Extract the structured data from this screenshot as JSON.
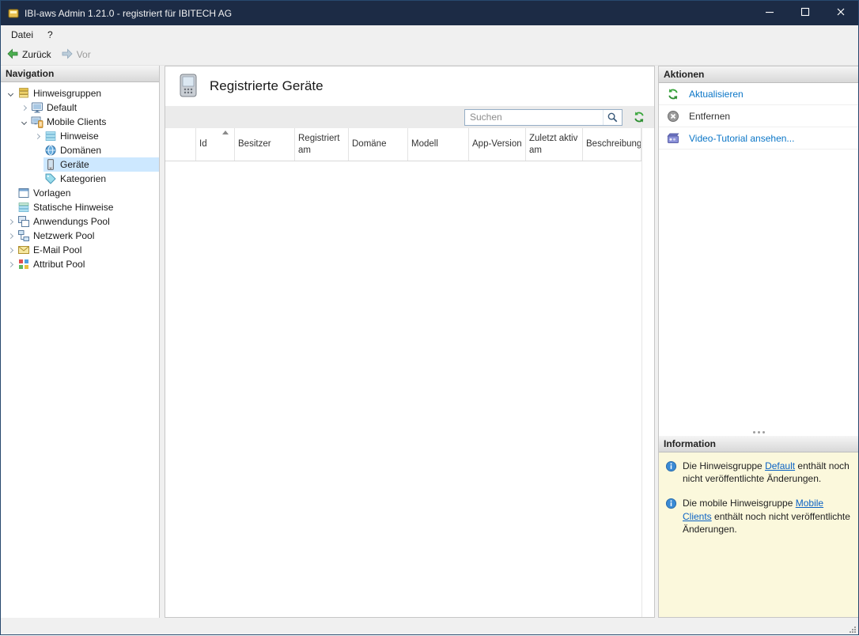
{
  "window": {
    "title": "IBI-aws Admin 1.21.0 - registriert für IBITECH AG",
    "controls": [
      "minimize",
      "maximize",
      "close"
    ]
  },
  "menu": {
    "items": [
      "Datei",
      "?"
    ]
  },
  "toolbar": {
    "back_label": "Zurück",
    "forward_label": "Vor"
  },
  "navigation": {
    "header": "Navigation",
    "tree": [
      {
        "label": "Hinweisgruppen",
        "level": 0,
        "expander": "open",
        "icon": "hint-groups",
        "selected": false
      },
      {
        "label": "Default",
        "level": 1,
        "expander": "closed",
        "icon": "default-group",
        "selected": false
      },
      {
        "label": "Mobile Clients",
        "level": 1,
        "expander": "open",
        "icon": "mobile-clients",
        "selected": false
      },
      {
        "label": "Hinweise",
        "level": 2,
        "expander": "closed",
        "icon": "hints",
        "selected": false
      },
      {
        "label": "Domänen",
        "level": 2,
        "expander": "none",
        "icon": "domains",
        "selected": false
      },
      {
        "label": "Geräte",
        "level": 2,
        "expander": "none",
        "icon": "devices",
        "selected": true
      },
      {
        "label": "Kategorien",
        "level": 2,
        "expander": "none",
        "icon": "categories",
        "selected": false
      },
      {
        "label": "Vorlagen",
        "level": 0,
        "expander": "none",
        "icon": "templates",
        "selected": false
      },
      {
        "label": "Statische Hinweise",
        "level": 0,
        "expander": "none",
        "icon": "static-hints",
        "selected": false
      },
      {
        "label": "Anwendungs Pool",
        "level": 0,
        "expander": "closed",
        "icon": "application-pool",
        "selected": false
      },
      {
        "label": "Netzwerk Pool",
        "level": 0,
        "expander": "closed",
        "icon": "network-pool",
        "selected": false
      },
      {
        "label": "E-Mail Pool",
        "level": 0,
        "expander": "closed",
        "icon": "email-pool",
        "selected": false
      },
      {
        "label": "Attribut Pool",
        "level": 0,
        "expander": "closed",
        "icon": "attribute-pool",
        "selected": false
      }
    ]
  },
  "main": {
    "title": "Registrierte Geräte",
    "icon": "mobile-device",
    "search_placeholder": "Suchen",
    "columns": [
      "Id",
      "Besitzer",
      "Registriert am",
      "Domäne",
      "Modell",
      "App-Version",
      "Zuletzt aktiv am",
      "Beschreibung"
    ],
    "sort": {
      "column": "Id",
      "direction": "ascending"
    },
    "rows": []
  },
  "actions": {
    "header": "Aktionen",
    "items": [
      {
        "label": "Aktualisieren",
        "icon": "refresh",
        "style": "link"
      },
      {
        "label": "Entfernen",
        "icon": "remove",
        "style": "default"
      },
      {
        "label": "Video-Tutorial ansehen...",
        "icon": "video",
        "style": "link"
      }
    ]
  },
  "information": {
    "header": "Information",
    "messages": [
      {
        "text_before": "Die Hinweisgruppe ",
        "link": "Default",
        "text_after": " enthält noch nicht veröffentlichte Änderungen."
      },
      {
        "text_before": "Die mobile Hinweisgruppe ",
        "link": "Mobile Clients",
        "text_after": " enthält noch nicht veröffentlichte Änderungen."
      }
    ]
  },
  "colors": {
    "titlebar": "#1c2b45",
    "selection": "#cde8ff",
    "link": "#0b76c7",
    "info_background": "#fbf8dc",
    "accent_green": "#3aa63d"
  }
}
